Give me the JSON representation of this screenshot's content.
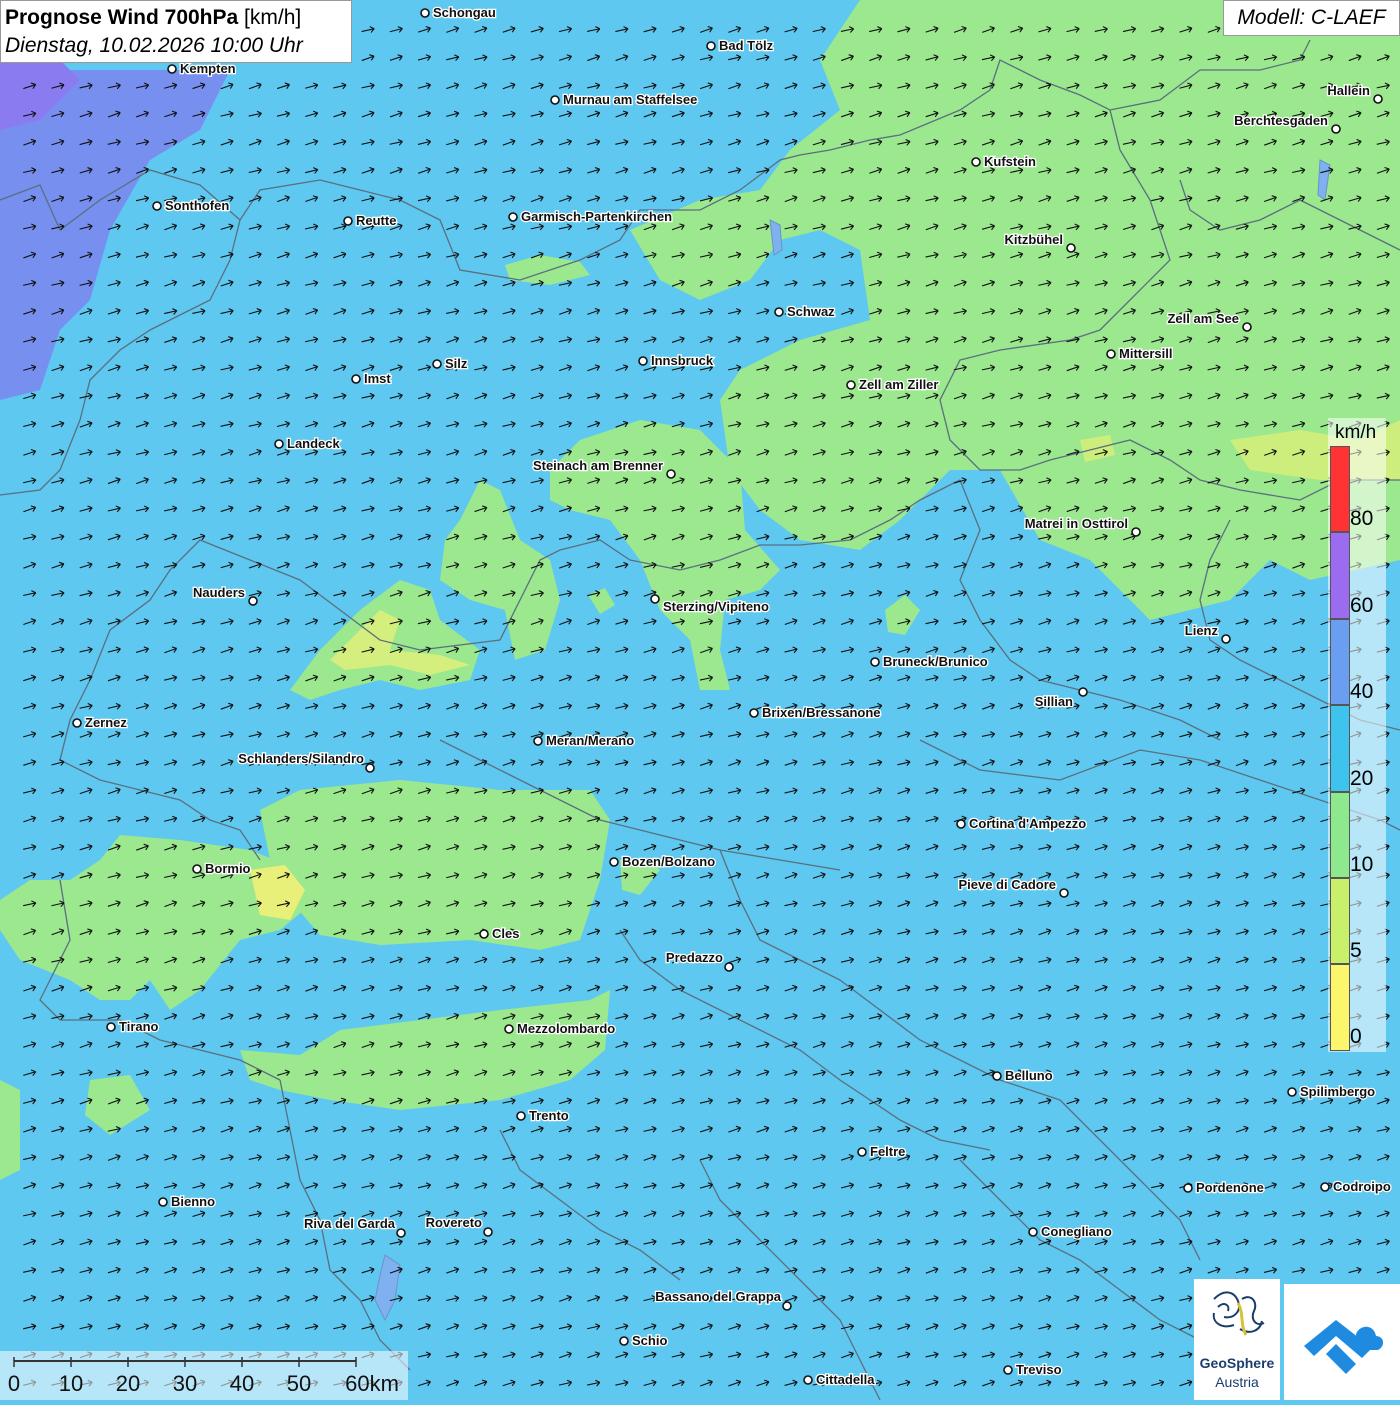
{
  "header": {
    "title": "Prognose Wind 700hPa",
    "unit": "[km/h]",
    "datetime": "Dienstag, 10.02.2026 10:00 Uhr"
  },
  "model": "Modell: C-LAEF",
  "legend": {
    "unit": "km/h",
    "ticks": [
      "80",
      "60",
      "40",
      "20",
      "10",
      "5",
      "0"
    ],
    "colors": [
      "#ff3333",
      "#c9d4f7",
      "#9b6cf0",
      "#6a9ef0",
      "#3ec3ee",
      "#8ee88e",
      "#c8f06a",
      "#fbf66b"
    ]
  },
  "scale": {
    "labels": [
      "0",
      "10",
      "20",
      "30",
      "40",
      "50",
      "60km"
    ]
  },
  "logo": {
    "line1": "GeoSphere",
    "line2": "Austria",
    "icon": "geosphere-logo-icon",
    "app_icon": "cloud-app-icon"
  },
  "colors": {
    "water": "#5ec8f0",
    "low_wind": "#9be88e",
    "lower_wind": "#e1f07a",
    "strong_wind": "#7a8cf0",
    "boundary": "#5a6f7f"
  },
  "cities": [
    {
      "name": "Schongau"
    },
    {
      "name": "Bad Tölz"
    },
    {
      "name": "Kempten"
    },
    {
      "name": "Murnau am Staffelsee"
    },
    {
      "name": "Hallein"
    },
    {
      "name": "Berchtesgaden"
    },
    {
      "name": "Kufstein"
    },
    {
      "name": "Sonthofen"
    },
    {
      "name": "Reutte"
    },
    {
      "name": "Garmisch-Partenkirchen"
    },
    {
      "name": "Kitzbühel"
    },
    {
      "name": "Schwaz"
    },
    {
      "name": "Zell am See"
    },
    {
      "name": "Mittersill"
    },
    {
      "name": "Innsbruck"
    },
    {
      "name": "Silz"
    },
    {
      "name": "Imst"
    },
    {
      "name": "Zell am Ziller"
    },
    {
      "name": "Landeck"
    },
    {
      "name": "Steinach am Brenner"
    },
    {
      "name": "Matrei in Osttirol"
    },
    {
      "name": "Nauders"
    },
    {
      "name": "Sterzing/Vipiteno"
    },
    {
      "name": "Lienz"
    },
    {
      "name": "Bruneck/Brunico"
    },
    {
      "name": "Sillian"
    },
    {
      "name": "Brixen/Bressanone"
    },
    {
      "name": "Zernez"
    },
    {
      "name": "Meran/Merano"
    },
    {
      "name": "Schlanders/Silandro"
    },
    {
      "name": "Cortina d'Ampezzo"
    },
    {
      "name": "Bozen/Bolzano"
    },
    {
      "name": "Bormio"
    },
    {
      "name": "Pieve di Cadore"
    },
    {
      "name": "Cles"
    },
    {
      "name": "Predazzo"
    },
    {
      "name": "Tirano"
    },
    {
      "name": "Mezzolombardo"
    },
    {
      "name": "Belluno"
    },
    {
      "name": "Spilimbergo"
    },
    {
      "name": "Trento"
    },
    {
      "name": "Feltre"
    },
    {
      "name": "Pordenone"
    },
    {
      "name": "Codroipo"
    },
    {
      "name": "Bienno"
    },
    {
      "name": "Riva del Garda"
    },
    {
      "name": "Rovereto"
    },
    {
      "name": "Conegliano"
    },
    {
      "name": "Bassano del Grappa"
    },
    {
      "name": "Schio"
    },
    {
      "name": "Treviso"
    },
    {
      "name": "Cittadella"
    }
  ]
}
